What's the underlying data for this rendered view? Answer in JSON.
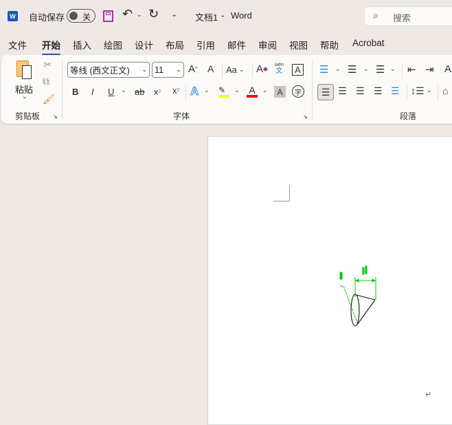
{
  "titlebar": {
    "autosave_label": "自动保存",
    "autosave_state": "关",
    "doc_title": "文档1",
    "separator": "-",
    "app_name": "Word",
    "search_placeholder": "搜索",
    "icons": [
      "word-logo-icon",
      "save-icon",
      "undo-icon",
      "redo-icon",
      "customize-icon",
      "search-icon"
    ]
  },
  "tabs": [
    "文件",
    "开始",
    "插入",
    "绘图",
    "设计",
    "布局",
    "引用",
    "邮件",
    "审阅",
    "视图",
    "帮助",
    "Acrobat"
  ],
  "active_tab": "开始",
  "ribbon": {
    "clipboard": {
      "paste_label": "粘贴",
      "group_label": "剪贴板"
    },
    "font": {
      "font_name": "等线 (西文正文)",
      "font_size": "11",
      "group_label": "字体",
      "aa_label": "Aa",
      "bold": "B",
      "italic": "I",
      "underline": "U",
      "strike": "ab",
      "sub": "x",
      "sup": "x",
      "phonetic_top": "wén",
      "phonetic_bottom": "文",
      "border_char": "A",
      "enclose_char": "字",
      "highlight_color": "#ffff00",
      "font_color": "#ff0000"
    },
    "paragraph": {
      "group_label": "段落"
    }
  },
  "colors": {
    "accent": "#2b579a",
    "save_icon": "#a4309c",
    "drawing_dim": "#00cc00"
  }
}
